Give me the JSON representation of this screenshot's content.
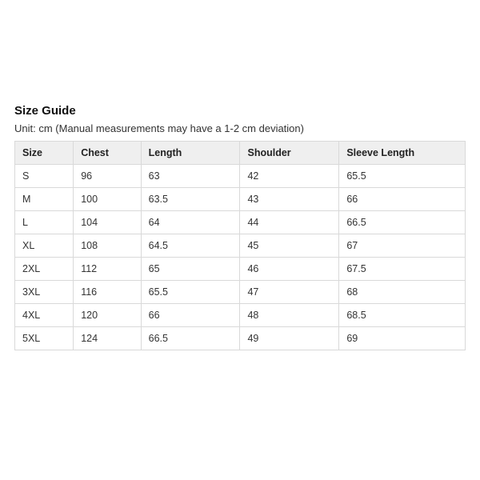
{
  "title": "Size Guide",
  "subtitle": "Unit: cm (Manual measurements may have a 1-2 cm deviation)",
  "headers": {
    "size": "Size",
    "chest": "Chest",
    "length": "Length",
    "shoulder": "Shoulder",
    "sleeve": "Sleeve Length"
  },
  "rows": [
    {
      "size": "S",
      "chest": "96",
      "length": "63",
      "shoulder": "42",
      "sleeve": "65.5"
    },
    {
      "size": "M",
      "chest": "100",
      "length": "63.5",
      "shoulder": "43",
      "sleeve": "66"
    },
    {
      "size": "L",
      "chest": "104",
      "length": "64",
      "shoulder": "44",
      "sleeve": "66.5"
    },
    {
      "size": "XL",
      "chest": "108",
      "length": "64.5",
      "shoulder": "45",
      "sleeve": "67"
    },
    {
      "size": "2XL",
      "chest": "112",
      "length": "65",
      "shoulder": "46",
      "sleeve": "67.5"
    },
    {
      "size": "3XL",
      "chest": "116",
      "length": "65.5",
      "shoulder": "47",
      "sleeve": "68"
    },
    {
      "size": "4XL",
      "chest": "120",
      "length": "66",
      "shoulder": "48",
      "sleeve": "68.5"
    },
    {
      "size": "5XL",
      "chest": "124",
      "length": "66.5",
      "shoulder": "49",
      "sleeve": "69"
    }
  ],
  "chart_data": {
    "type": "table",
    "title": "Size Guide",
    "columns": [
      "Size",
      "Chest",
      "Length",
      "Shoulder",
      "Sleeve Length"
    ],
    "rows": [
      [
        "S",
        96,
        63,
        42,
        65.5
      ],
      [
        "M",
        100,
        63.5,
        43,
        66
      ],
      [
        "L",
        104,
        64,
        44,
        66.5
      ],
      [
        "XL",
        108,
        64.5,
        45,
        67
      ],
      [
        "2XL",
        112,
        65,
        46,
        67.5
      ],
      [
        "3XL",
        116,
        65.5,
        47,
        68
      ],
      [
        "4XL",
        120,
        66,
        48,
        68.5
      ],
      [
        "5XL",
        124,
        66.5,
        49,
        69
      ]
    ],
    "unit": "cm"
  }
}
